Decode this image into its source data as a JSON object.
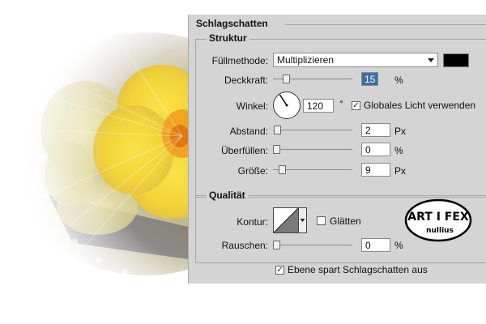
{
  "dialog": {
    "section_title": "Schlagschatten",
    "structure": {
      "title": "Struktur",
      "blend_mode_label": "Füllmethode:",
      "blend_mode_value": "Multiplizieren",
      "shadow_color": "#000000",
      "opacity_label": "Deckkraft:",
      "opacity_value": "15",
      "opacity_unit": "%",
      "opacity_level": 0.15,
      "angle_label": "Winkel:",
      "angle_value": "120",
      "angle_unit": "°",
      "global_light_label": "Globales Licht verwenden",
      "global_light_checked": true,
      "distance_label": "Abstand:",
      "distance_value": "2",
      "distance_unit": "Px",
      "spread_label": "Überfüllen:",
      "spread_value": "0",
      "spread_unit": "%",
      "size_label": "Größe:",
      "size_value": "9",
      "size_unit": "Px"
    },
    "quality": {
      "title": "Qualität",
      "contour_label": "Kontur:",
      "antialias_label": "Glätten",
      "antialias_checked": false,
      "noise_label": "Rauschen:",
      "noise_value": "0",
      "noise_unit": "%"
    },
    "knockout_label": "Ebene spart Schlagschatten aus",
    "knockout_checked": true
  },
  "logo": {
    "line1": "ART I FEX",
    "line2": "nullius"
  }
}
